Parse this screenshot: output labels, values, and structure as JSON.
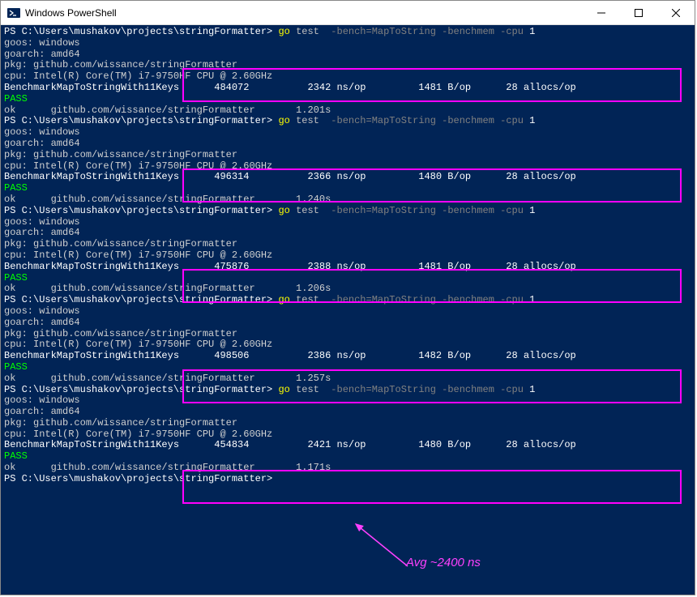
{
  "window": {
    "title": "Windows PowerShell"
  },
  "prompt": {
    "ps": "PS",
    "path": "C:\\Users\\mushakov\\projects\\stringFormatter>",
    "cmd_go": "go",
    "cmd_test": "test",
    "flag_bench": "-bench=MapToString",
    "flag_benchmem": "-benchmem",
    "flag_cpu": "-cpu",
    "cpu_n": "1"
  },
  "common": {
    "goos": "goos: windows",
    "goarch": "goarch: amd64",
    "pkg": "pkg: github.com/wissance/stringFormatter",
    "cpu": "cpu: Intel(R) Core(TM) i7-9750HF CPU @ 2.60GHz",
    "bench_name": "BenchmarkMapToStringWith11Keys",
    "pass": "PASS",
    "ok_prefix": "ok",
    "ok_pkg": "github.com/wissance/stringFormatter"
  },
  "runs": [
    {
      "iter": "484072",
      "nsop": "2342 ns/op",
      "bop": "1481 B/op",
      "allocs": "28 allocs/op",
      "time": "1.201s"
    },
    {
      "iter": "496314",
      "nsop": "2366 ns/op",
      "bop": "1480 B/op",
      "allocs": "28 allocs/op",
      "time": "1.240s"
    },
    {
      "iter": "475876",
      "nsop": "2388 ns/op",
      "bop": "1481 B/op",
      "allocs": "28 allocs/op",
      "time": "1.206s"
    },
    {
      "iter": "498506",
      "nsop": "2386 ns/op",
      "bop": "1482 B/op",
      "allocs": "28 allocs/op",
      "time": "1.257s"
    },
    {
      "iter": "454834",
      "nsop": "2421 ns/op",
      "bop": "1480 B/op",
      "allocs": "28 allocs/op",
      "time": "1.171s"
    }
  ],
  "annotation": {
    "text": "Avg ~2400 ns"
  }
}
